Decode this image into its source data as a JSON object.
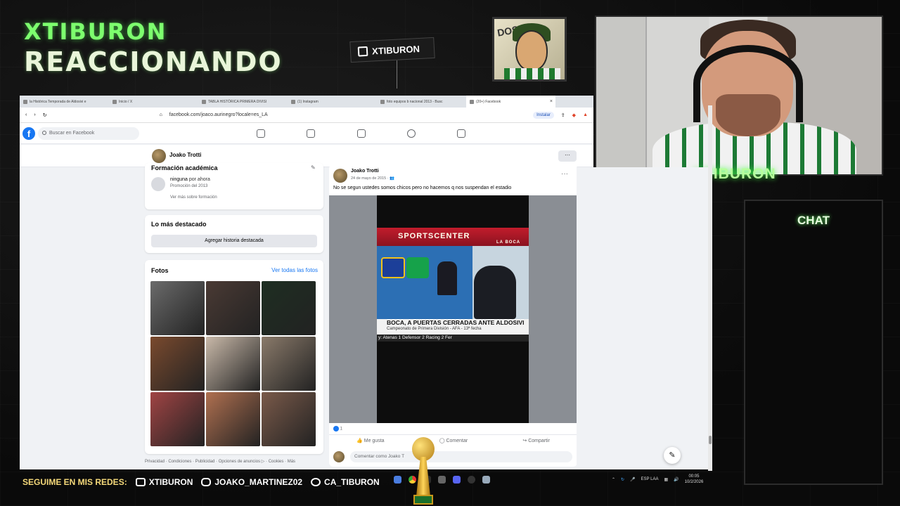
{
  "overlay": {
    "title_line1": "XTIBURON",
    "title_line2": "REACCIONANDO",
    "twitch_name": "XTIBURON",
    "cam_label": "XTIBURON",
    "chat_title": "CHAT",
    "avatar_paper_text": "DOSIS"
  },
  "browser": {
    "tabs": [
      {
        "label": "la Histórica Temporada de Aldosivi e",
        "active": false
      },
      {
        "label": "Inicio / X",
        "active": false
      },
      {
        "label": "TABLA HISTÓRICA PRIMERA DIVISI",
        "active": false
      },
      {
        "label": "(1) Instagram",
        "active": false
      },
      {
        "label": "foto equipos b nacional 2013 - Busc",
        "active": false
      },
      {
        "label": "(20+) Facebook",
        "active": true
      }
    ],
    "url": "facebook.com/joaco.aurinegro?locale=es_LA",
    "install_label": "Instalar"
  },
  "facebook": {
    "search_placeholder": "Buscar en Facebook",
    "profile_name": "Joako Trotti",
    "more_label": "···",
    "education": {
      "heading": "Formación académica",
      "item_title": "ninguna",
      "item_suffix": "por ahora",
      "item_sub": "Promoción del 2013",
      "link": "Ver más sobre formación"
    },
    "highlights": {
      "heading": "Lo más destacado",
      "button": "Agregar historia destacada"
    },
    "photos": {
      "heading": "Fotos",
      "link": "Ver todas las fotos",
      "colors": [
        "#6b6b6b",
        "#4a3a34",
        "#1e2e22",
        "#7a4a2e",
        "#c9b9a9",
        "#8a7a6a",
        "#a04444",
        "#b07050",
        "#7a5a4a"
      ]
    },
    "footer": "Privacidad · Condiciones · Publicidad · Opciones de anuncios ▷ · Cookies · Más",
    "post": {
      "author": "Joako Trotti",
      "date": "24 de mayo de 2015 · ",
      "text": "No se segun ustedes somos chicos pero no hacemos q nos suspendan el estadio",
      "video": {
        "top_banner": "SPORTSCENTER",
        "location": "LA BOCA",
        "headline": "BOCA, A PUERTAS CERRADAS ANTE ALDOSIVI",
        "subheadline": "Campeonato de Primera División - AFA - 13ª fecha",
        "ticker": "y: Atenas 1 Defensor 2 Racing 2 Fer"
      },
      "reactions": "1",
      "actions": {
        "like": "Me gusta",
        "comment": "Comentar",
        "share": "Compartir"
      },
      "comment_placeholder": "Comentar como Joako T"
    }
  },
  "bottom_bar": {
    "follow_label": "SEGUIME EN MIS REDES:",
    "youtube": "XTIBURON",
    "instagram": "JOAKO_MARTINEZ02",
    "twitter": "CA_TIBURON",
    "tray_lang": "ESP LAA",
    "tray_time": "00:05",
    "tray_date": "10/2/2026"
  }
}
